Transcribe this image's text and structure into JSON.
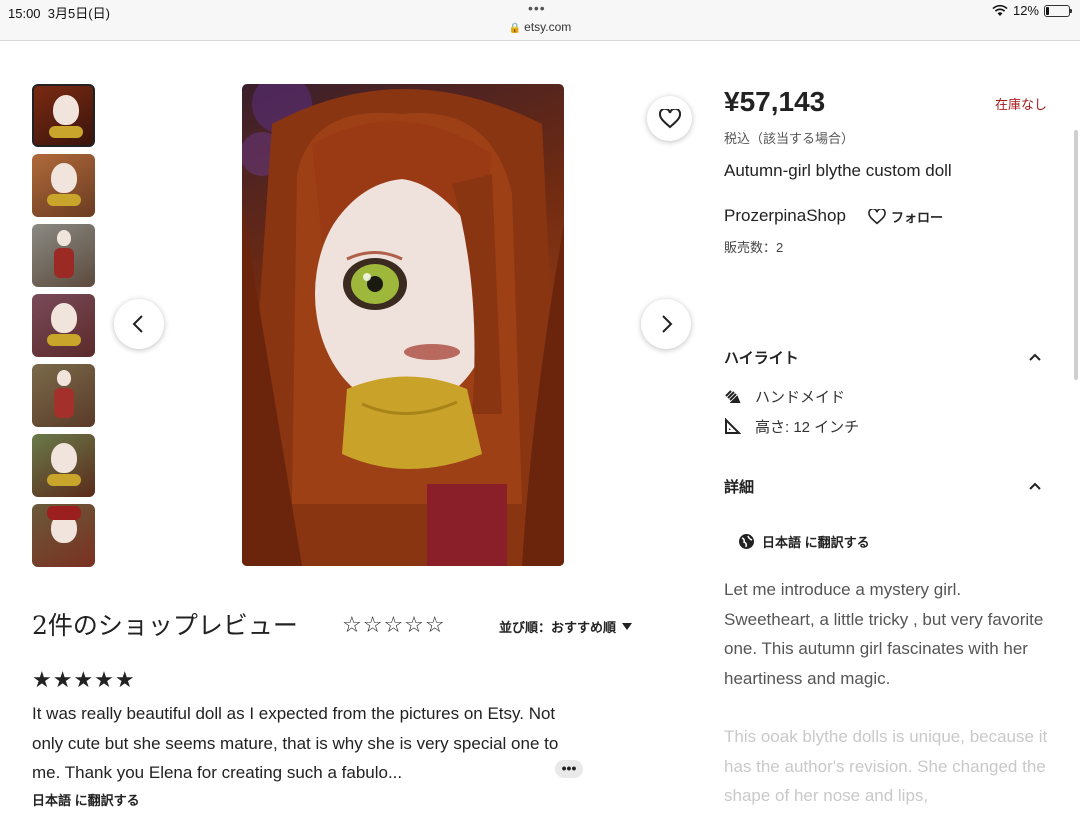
{
  "status_bar": {
    "time": "15:00",
    "date": "3月5日(日)",
    "url": "etsy.com",
    "battery": "12%",
    "battery_level": 0.12
  },
  "gallery": {
    "thumbnail_count": 7,
    "selected_index": 0,
    "prev_icon": "chevron-left-icon",
    "next_icon": "chevron-right-icon",
    "favorite_icon": "heart-icon"
  },
  "product": {
    "price": "¥57,143",
    "stock_status": "在庫なし",
    "tax_note": "税込（該当する場合）",
    "title": "Autumn-girl blythe custom doll",
    "shop_name": "ProzerpinaShop",
    "follow_label": "フォロー",
    "sales_count": "販売数：2"
  },
  "highlights": {
    "heading": "ハイライト",
    "items": [
      {
        "icon": "hand-icon",
        "label": "ハンドメイド"
      },
      {
        "icon": "ruler-triangle-icon",
        "label": "高さ: 12 インチ"
      }
    ]
  },
  "details": {
    "heading": "詳細",
    "translate_label": "日本語 に翻訳する",
    "description_1": "Let me introduce a mystery girl. Sweetheart, a little tricky , but very favorite one. This autumn girl fascinates with her heartiness and magic.",
    "description_2": "This ooak blythe dolls is unique, because it has the author's revision. She changed the shape of her nose and lips,"
  },
  "reviews": {
    "heading": "2件のショップレビュー",
    "rating_stars": "☆☆☆☆☆",
    "sort_label": "並び順：おすすめ順",
    "review": {
      "stars": "★★★★★",
      "text": "It was really beautiful doll as I expected from the pictures on Etsy. Not only cute but she seems mature, that is why she is very special one to me. Thank you Elena for creating such a fabulo...",
      "more_label": "•••",
      "translate_label": "日本語 に翻訳する"
    }
  },
  "colors": {
    "stock": "#a61a1a",
    "text": "#222222",
    "muted": "#555555"
  }
}
